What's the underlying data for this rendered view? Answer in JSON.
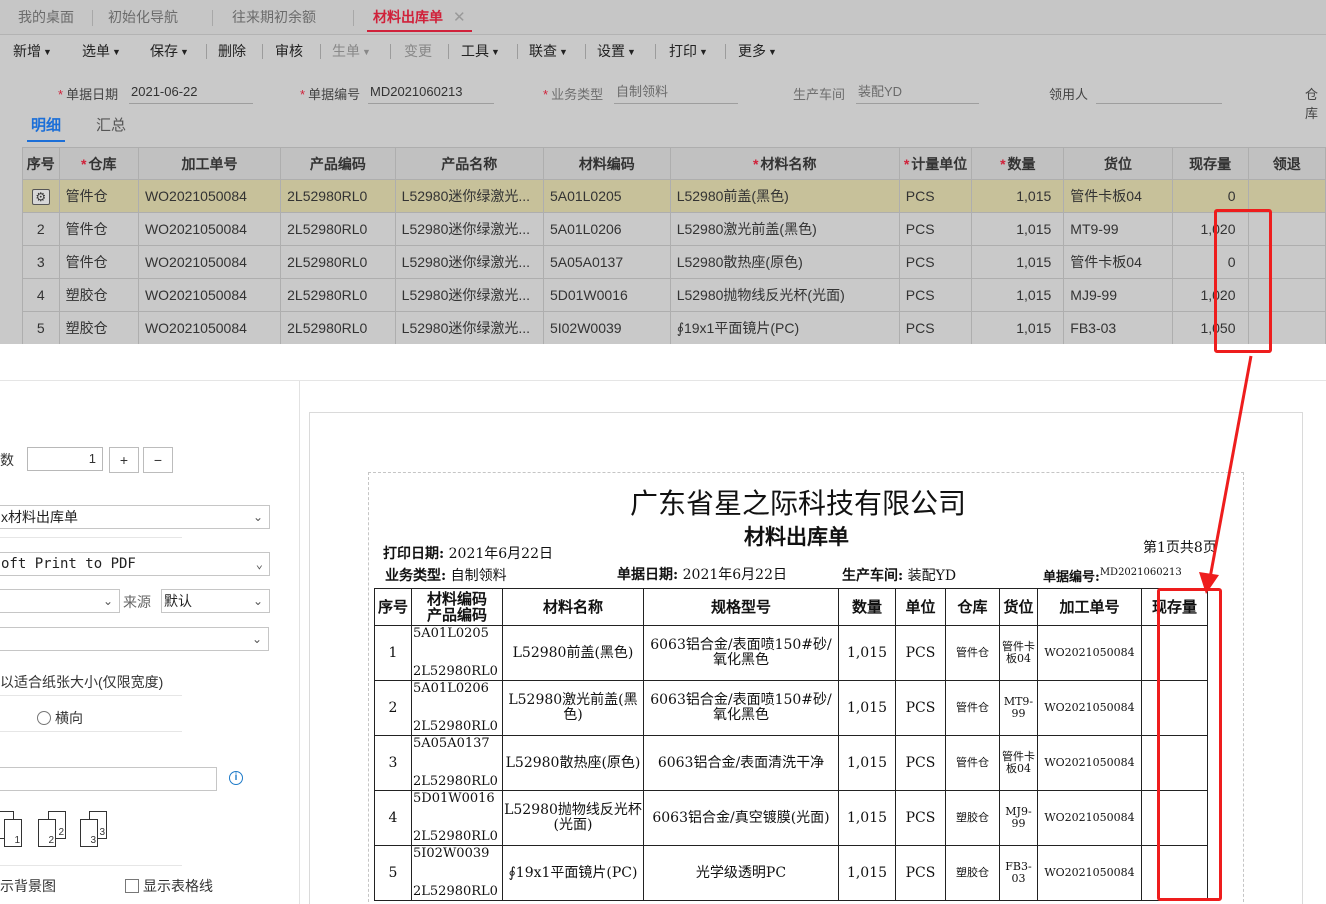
{
  "tabs": [
    {
      "label": "我的桌面"
    },
    {
      "label": "初始化导航"
    },
    {
      "label": "往来期初余额"
    },
    {
      "label": "材料出库单",
      "close": "✕"
    }
  ],
  "toolbar": {
    "new": "新增",
    "select": "选单",
    "save": "保存",
    "delete": "删除",
    "audit": "审核",
    "generate": "生单",
    "change": "变更",
    "tools": "工具",
    "query": "联查",
    "settings": "设置",
    "print": "打印",
    "more": "更多"
  },
  "form": {
    "date_label": "单据日期",
    "date_value": "2021-06-22",
    "no_label": "单据编号",
    "no_value": "MD2021060213",
    "biz_label": "业务类型",
    "biz_value": "自制领料",
    "workshop_label": "生产车间",
    "workshop_value": "装配YD",
    "receiver_label": "领用人",
    "receiver_value": "",
    "warehouse_label": "仓库"
  },
  "subtabs": {
    "detail": "明细",
    "summary": "汇总"
  },
  "grid": {
    "headers": {
      "seq": "序号",
      "wh": "仓库",
      "wo": "加工单号",
      "pcode": "产品编码",
      "pname": "产品名称",
      "mcode": "材料编码",
      "mname": "材料名称",
      "unit": "计量单位",
      "qty": "数量",
      "loc": "货位",
      "stock": "现存量",
      "ret": "领退"
    },
    "rows": [
      {
        "seq": "⚙",
        "wh": "管件仓",
        "wo": "WO2021050084",
        "pcode": "2L52980RL0",
        "pname": "L52980迷你绿激光...",
        "mcode": "5A01L0205",
        "mname": "L52980前盖(黑色)",
        "unit": "PCS",
        "qty": "1,015",
        "loc": "管件卡板04",
        "stock": "0"
      },
      {
        "seq": "2",
        "wh": "管件仓",
        "wo": "WO2021050084",
        "pcode": "2L52980RL0",
        "pname": "L52980迷你绿激光...",
        "mcode": "5A01L0206",
        "mname": "L52980激光前盖(黑色)",
        "unit": "PCS",
        "qty": "1,015",
        "loc": "MT9-99",
        "stock": "1,020"
      },
      {
        "seq": "3",
        "wh": "管件仓",
        "wo": "WO2021050084",
        "pcode": "2L52980RL0",
        "pname": "L52980迷你绿激光...",
        "mcode": "5A05A0137",
        "mname": "L52980散热座(原色)",
        "unit": "PCS",
        "qty": "1,015",
        "loc": "管件卡板04",
        "stock": "0"
      },
      {
        "seq": "4",
        "wh": "塑胶仓",
        "wo": "WO2021050084",
        "pcode": "2L52980RL0",
        "pname": "L52980迷你绿激光...",
        "mcode": "5D01W0016",
        "mname": "L52980抛物线反光杯(光面)",
        "unit": "PCS",
        "qty": "1,015",
        "loc": "MJ9-99",
        "stock": "1,020"
      },
      {
        "seq": "5",
        "wh": "塑胶仓",
        "wo": "WO2021050084",
        "pcode": "2L52980RL0",
        "pname": "L52980迷你绿激光...",
        "mcode": "5I02W0039",
        "mname": "∮19x1平面镜片(PC)",
        "unit": "PCS",
        "qty": "1,015",
        "loc": "FB3-03",
        "stock": "1,050"
      }
    ]
  },
  "print_settings": {
    "copies_label": "数",
    "copies_value": "1",
    "plus": "+",
    "minus": "−",
    "template": "x材料出库单",
    "printer": "oft Print to PDF",
    "source_label": "来源",
    "source_value": "默认",
    "fit_label": "以适合纸张大小(仅限宽度)",
    "landscape": "横向",
    "show_bg": "示背景图",
    "show_grid": "显示表格线",
    "page_icons": [
      "1",
      "2",
      "3"
    ]
  },
  "preview": {
    "company": "广东省星之际科技有限公司",
    "doc_title": "材料出库单",
    "print_date_label": "打印日期:",
    "print_date": "2021年6月22日",
    "page_info": "第1页共8页",
    "biz_label": "业务类型:",
    "biz_value": "自制领料",
    "date_label": "单据日期:",
    "date_value": "2021年6月22日",
    "workshop_label": "生产车间:",
    "workshop_value": "装配YD",
    "no_label": "单据编号:",
    "no_value": "MD2021060213",
    "headers": {
      "seq": "序号",
      "code1": "材料编码",
      "code2": "产品编码",
      "mname": "材料名称",
      "spec": "规格型号",
      "qty": "数量",
      "unit": "单位",
      "wh": "仓库",
      "loc": "货位",
      "wo": "加工单号",
      "stock": "现存量"
    },
    "rows": [
      {
        "seq": "1",
        "mcode": "5A01L0205",
        "pcode": "2L52980RL0",
        "mname": "L52980前盖(黑色)",
        "spec": "6063铝合金/表面喷150#砂/氧化黑色",
        "qty": "1,015",
        "unit": "PCS",
        "wh": "管件仓",
        "loc": "管件卡板04",
        "wo": "WO2021050084",
        "stock": ""
      },
      {
        "seq": "2",
        "mcode": "5A01L0206",
        "pcode": "2L52980RL0",
        "mname": "L52980激光前盖(黑色)",
        "spec": "6063铝合金/表面喷150#砂/氧化黑色",
        "qty": "1,015",
        "unit": "PCS",
        "wh": "管件仓",
        "loc": "MT9-99",
        "wo": "WO2021050084",
        "stock": ""
      },
      {
        "seq": "3",
        "mcode": "5A05A0137",
        "pcode": "2L52980RL0",
        "mname": "L52980散热座(原色)",
        "spec": "6063铝合金/表面清洗干净",
        "qty": "1,015",
        "unit": "PCS",
        "wh": "管件仓",
        "loc": "管件卡板04",
        "wo": "WO2021050084",
        "stock": ""
      },
      {
        "seq": "4",
        "mcode": "5D01W0016",
        "pcode": "2L52980RL0",
        "mname": "L52980抛物线反光杯(光面)",
        "spec": "6063铝合金/真空镀膜(光面)",
        "qty": "1,015",
        "unit": "PCS",
        "wh": "塑胶仓",
        "loc": "MJ9-99",
        "wo": "WO2021050084",
        "stock": ""
      },
      {
        "seq": "5",
        "mcode": "5I02W0039",
        "pcode": "2L52980RL0",
        "mname": "∮19x1平面镜片(PC)",
        "spec": "光学级透明PC",
        "qty": "1,015",
        "unit": "PCS",
        "wh": "塑胶仓",
        "loc": "FB3-03",
        "wo": "WO2021050084",
        "stock": ""
      }
    ]
  }
}
